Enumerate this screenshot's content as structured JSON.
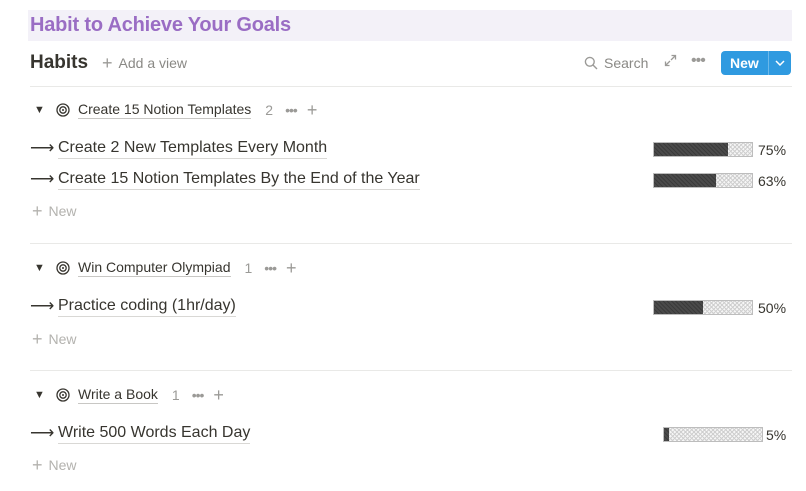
{
  "page": {
    "title": "Habit to Achieve Your Goals"
  },
  "toolbar": {
    "db_title": "Habits",
    "add_view": "Add a view",
    "search": "Search",
    "new_label": "New"
  },
  "groups": [
    {
      "name": "Create 15 Notion Templates",
      "count": "2",
      "items": [
        {
          "title": "Create 2 New Templates Every Month",
          "progress": 0.75,
          "progress_label": "75%"
        },
        {
          "title": "Create 15 Notion Templates By the End of the Year",
          "progress": 0.63,
          "progress_label": "63%"
        }
      ],
      "new_label": "New"
    },
    {
      "name": "Win Computer Olympiad",
      "count": "1",
      "items": [
        {
          "title": "Practice coding (1hr/day)",
          "progress": 0.5,
          "progress_label": "50%"
        }
      ],
      "new_label": "New"
    },
    {
      "name": "Write a Book",
      "count": "1",
      "items": [
        {
          "title": "Write 500 Words Each Day",
          "progress": 0.05,
          "progress_label": "5%"
        }
      ],
      "new_label": "New"
    }
  ],
  "colors": {
    "title": "#9a6dc4",
    "banner": "#f3f1f8",
    "accent": "#2f9ae0"
  },
  "icons": [
    "plus-icon",
    "search-icon",
    "expand-icon",
    "more-icon",
    "chevron-down-icon",
    "triangle-down-icon",
    "target-icon",
    "arrow-right-icon"
  ]
}
